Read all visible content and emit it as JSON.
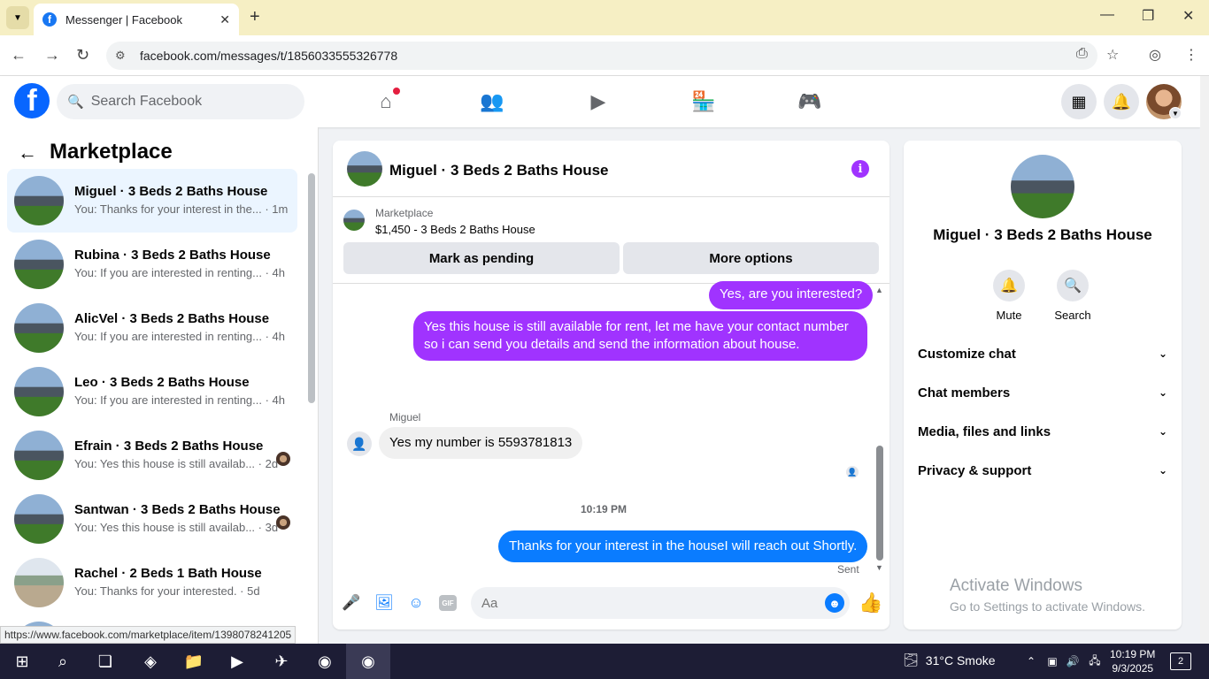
{
  "browser": {
    "tab_title": "Messenger | Facebook",
    "url": "facebook.com/messages/t/1856033555326778",
    "status_url": "https://www.facebook.com/marketplace/item/1398078241205"
  },
  "header": {
    "search_placeholder": "Search Facebook"
  },
  "left_panel": {
    "title": "Marketplace",
    "conversations": [
      {
        "name": "Miguel · 3 Beds 2 Baths House",
        "snippet": "You: Thanks for your interest in the... · 1m"
      },
      {
        "name": "Rubina · 3 Beds 2 Baths House",
        "snippet": "You: If you are interested in renting... · 4h"
      },
      {
        "name": "AlicVel · 3 Beds 2 Baths House",
        "snippet": "You: If you are interested in renting... · 4h"
      },
      {
        "name": "Leo · 3 Beds 2 Baths House",
        "snippet": "You: If you are interested in renting... · 4h"
      },
      {
        "name": "Efrain · 3 Beds 2 Baths House",
        "snippet": "You: Yes this house is still availab... · 2d"
      },
      {
        "name": "Santwan · 3 Beds 2 Baths House",
        "snippet": "You: Yes this house is still availab... · 3d"
      },
      {
        "name": "Rachel · 2 Beds 1 Bath House",
        "snippet": "You: Thanks for your interested. · 5d"
      }
    ]
  },
  "chat": {
    "title": "Miguel · 3 Beds 2 Baths House",
    "marketplace_label": "Marketplace",
    "listing": "$1,450 - 3 Beds 2 Baths House",
    "mark_pending": "Mark as pending",
    "more_options": "More options",
    "messages": {
      "m1": "Yes, are you interested?",
      "m2": "Yes this house is still available for rent, let me have your contact number so i can send you details and send the information about house.",
      "sender": "Miguel",
      "m3": "Yes my number is 5593781813",
      "time": "10:19 PM",
      "m4": "Thanks for your interest in the houseI will reach out Shortly.",
      "sent": "Sent"
    },
    "input_placeholder": "Aa"
  },
  "right_panel": {
    "name": "Miguel · 3 Beds 2 Baths House",
    "mute": "Mute",
    "search": "Search",
    "sections": [
      "Customize chat",
      "Chat members",
      "Media, files and links",
      "Privacy & support"
    ],
    "activate_title": "Activate Windows",
    "activate_sub": "Go to Settings to activate Windows."
  },
  "taskbar": {
    "weather": "31°C  Smoke",
    "time": "10:19 PM",
    "date": "9/3/2025",
    "notifications": "2"
  }
}
